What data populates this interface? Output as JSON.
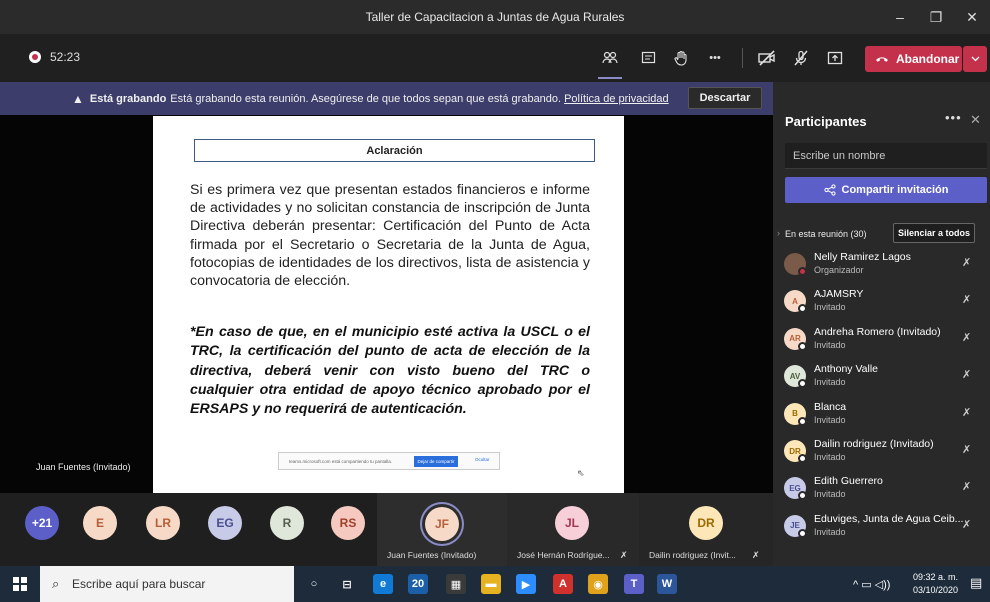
{
  "window": {
    "title": "Taller de Capacitacion a Juntas de Agua Rurales",
    "minimize": "–",
    "maximize": "❐",
    "close": "✕"
  },
  "toolbar": {
    "timer": "52:23",
    "leave_label": "Abandonar",
    "leave_dropdown": "⌄",
    "icons": {
      "participants": "👥",
      "chat": "▤",
      "raise_hand": "✋",
      "more": "•••",
      "camera_off": "✎",
      "mic_off": "🎙",
      "share": "⇪"
    }
  },
  "banner": {
    "bold": "Está grabando",
    "message": "Está grabando esta reunión. Asegúrese de que todos sepan que está grabando.",
    "link": "Política de privacidad",
    "dismiss": "Descartar"
  },
  "slide": {
    "title": "Aclaración",
    "paragraph": "Si es primera vez que presentan estados financieros e informe de actividades y no solicitan constancia de inscripción de Junta Directiva deberán presentar: Certificación del Punto de Acta firmada por el Secretario o Secretaria de la Junta de Agua, fotocopias de identidades de los directivos, lista de asistencia y convocatoria de elección.",
    "note": "*En caso de que, en el municipio esté activa la USCL o el TRC, la certificación del punto de acta de elección de la directiva, deberá venir con visto bueno del TRC o cualquier otra entidad de apoyo técnico aprobado por el ERSAPS y no requerirá de autenticación.",
    "share_text": "teams.microsoft.com está compartiendo tu pantalla.",
    "share_stop": "Dejar de compartir",
    "share_hide": "Ocultar"
  },
  "presenter": {
    "name": "Juan Fuentes (Invitado)"
  },
  "strip": {
    "overflow": "+21",
    "avatars": [
      {
        "initials": "E",
        "bg": "#f6dac7",
        "fg": "#b5603a"
      },
      {
        "initials": "LR",
        "bg": "#f6dac7",
        "fg": "#b5603a"
      },
      {
        "initials": "EG",
        "bg": "#c7cbe8",
        "fg": "#4a4f8f"
      },
      {
        "initials": "R",
        "bg": "#dfe6da",
        "fg": "#555f4d"
      },
      {
        "initials": "RS",
        "bg": "#f5c9c0",
        "fg": "#a0402c"
      }
    ],
    "tiles": [
      {
        "initials": "JF",
        "label": "Juan Fuentes (Invitado)",
        "bg": "#f6dac7",
        "fg": "#b5603a"
      },
      {
        "initials": "JL",
        "label": "José Hernán Rodrígue...",
        "bg": "#f6cfd8",
        "fg": "#a43553"
      },
      {
        "initials": "DR",
        "label": "Dailin rodriguez (Invit...",
        "bg": "#fde7b8",
        "fg": "#9b6a00"
      }
    ]
  },
  "panel": {
    "title": "Participantes",
    "more": "•••",
    "close": "✕",
    "search_placeholder": "Escribe un nombre",
    "invite": "Compartir invitación",
    "in_meeting": "En esta reunión (30)",
    "mute_all": "Silenciar a todos",
    "participants": [
      {
        "name": "Nelly Ramirez Lagos",
        "role": "Organizador",
        "initials": "",
        "bg": "#7a5a48",
        "fg": "#fff",
        "organizer": true
      },
      {
        "name": "AJAMSRY",
        "role": "Invitado",
        "initials": "A",
        "bg": "#f6dac7",
        "fg": "#b5603a",
        "organizer": false
      },
      {
        "name": "Andreha Romero (Invitado)",
        "role": "Invitado",
        "initials": "AR",
        "bg": "#f6dac7",
        "fg": "#b5603a",
        "organizer": false
      },
      {
        "name": "Anthony Valle",
        "role": "Invitado",
        "initials": "AV",
        "bg": "#dfe6da",
        "fg": "#4a5f3e",
        "organizer": false
      },
      {
        "name": "Blanca",
        "role": "Invitado",
        "initials": "B",
        "bg": "#fde7b8",
        "fg": "#9b6a00",
        "organizer": false
      },
      {
        "name": "Dailin rodriguez (Invitado)",
        "role": "Invitado",
        "initials": "DR",
        "bg": "#fde7b8",
        "fg": "#9b6a00",
        "organizer": false
      },
      {
        "name": "Edith Guerrero",
        "role": "Invitado",
        "initials": "EG",
        "bg": "#c7cbe8",
        "fg": "#4a4f8f",
        "organizer": false
      },
      {
        "name": "Eduviges, Junta de Agua Ceib...",
        "role": "Invitado",
        "initials": "JE",
        "bg": "#c7cbe8",
        "fg": "#4a4f8f",
        "organizer": false
      }
    ]
  },
  "taskbar": {
    "search_placeholder": "Escribe aquí para buscar",
    "apps": [
      {
        "name": "cortana",
        "glyph": "○",
        "bg": "transparent"
      },
      {
        "name": "task-view",
        "glyph": "⊟",
        "bg": "transparent"
      },
      {
        "name": "edge",
        "glyph": "e",
        "bg": "#0f7bd6"
      },
      {
        "name": "mail",
        "glyph": "20",
        "bg": "#1a5fa8"
      },
      {
        "name": "store",
        "glyph": "▦",
        "bg": "#3a3a3a"
      },
      {
        "name": "file-explorer",
        "glyph": "▬",
        "bg": "#e7b21f"
      },
      {
        "name": "zoom",
        "glyph": "▶",
        "bg": "#2d8cff"
      },
      {
        "name": "acrobat",
        "glyph": "A",
        "bg": "#d0312d"
      },
      {
        "name": "chrome",
        "glyph": "◉",
        "bg": "#e0a21a"
      },
      {
        "name": "teams",
        "glyph": "T",
        "bg": "#5b5fc7"
      },
      {
        "name": "word",
        "glyph": "W",
        "bg": "#2b579a"
      }
    ],
    "tray": "^ ▭ ◁))",
    "time": "09:32 a. m.",
    "date": "03/10/2020",
    "notification": "▤"
  }
}
